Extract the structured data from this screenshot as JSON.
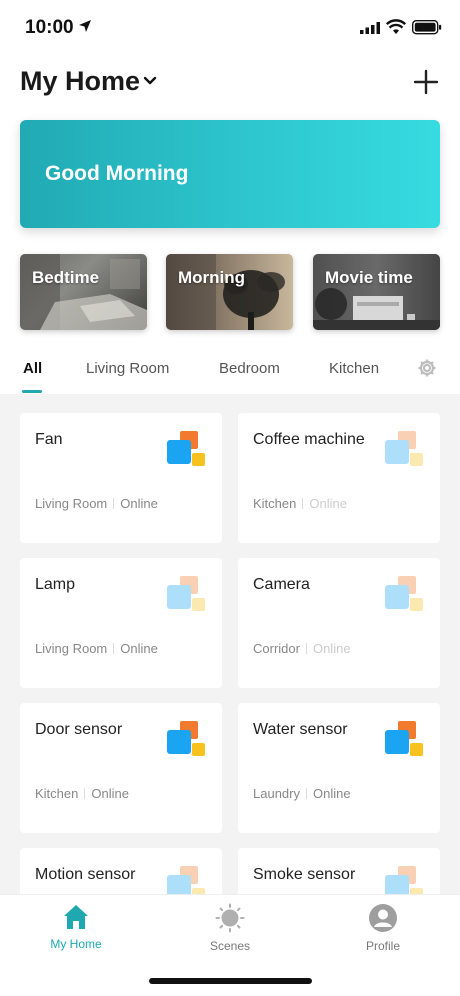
{
  "status_bar": {
    "time": "10:00"
  },
  "header": {
    "title": "My Home"
  },
  "banner": {
    "greeting": "Good Morning"
  },
  "scenes": [
    {
      "label": "Bedtime"
    },
    {
      "label": "Morning"
    },
    {
      "label": "Movie time"
    }
  ],
  "tabs": [
    {
      "label": "All",
      "active": true
    },
    {
      "label": "Living Room"
    },
    {
      "label": "Bedroom"
    },
    {
      "label": "Kitchen"
    }
  ],
  "devices": [
    {
      "name": "Fan",
      "room": "Living Room",
      "status": "Online",
      "active": true
    },
    {
      "name": "Coffee machine",
      "room": "Kitchen",
      "status": "Online",
      "active": false
    },
    {
      "name": "Lamp",
      "room": "Living Room",
      "status": "Online",
      "active": false
    },
    {
      "name": "Camera",
      "room": "Corridor",
      "status": "Online",
      "active": false
    },
    {
      "name": "Door sensor",
      "room": "Kitchen",
      "status": "Online",
      "active": true
    },
    {
      "name": "Water sensor",
      "room": "Laundry",
      "status": "Online",
      "active": true
    },
    {
      "name": "Motion sensor",
      "room": "",
      "status": "",
      "active": false
    },
    {
      "name": "Smoke sensor",
      "room": "",
      "status": "",
      "active": false
    }
  ],
  "bottom_nav": [
    {
      "label": "My Home",
      "icon": "home-icon",
      "active": true
    },
    {
      "label": "Scenes",
      "icon": "sun-icon"
    },
    {
      "label": "Profile",
      "icon": "person-icon"
    }
  ],
  "colors": {
    "accent": "#1fa8b0",
    "banner_start": "#21aab3",
    "banner_end": "#36dbe0"
  }
}
